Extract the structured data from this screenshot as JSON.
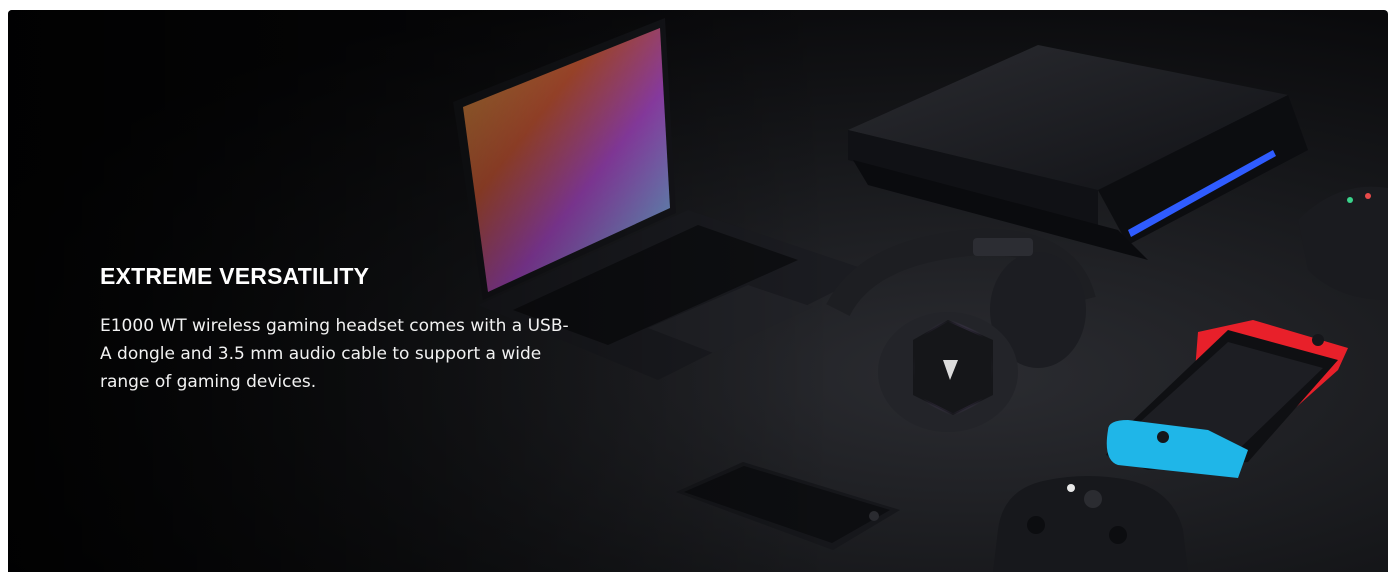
{
  "feature": {
    "headline": "EXTREME VERSATILITY",
    "description": "E1000 WT wireless gaming headset comes with a USB-A dongle and 3.5 mm audio cable to support a wide range of gaming devices."
  },
  "scene": {
    "devices": [
      "laptop-icon",
      "game-console-icon",
      "headset-icon",
      "smartphone-icon",
      "handheld-console-icon",
      "gamepad-icon"
    ],
    "colors": {
      "background": "#0b0b0d",
      "console_light": "#2f5cff",
      "handheld_left": "#1fb6e8",
      "handheld_right": "#e8202a",
      "headset_glow": "#c48cff"
    }
  }
}
